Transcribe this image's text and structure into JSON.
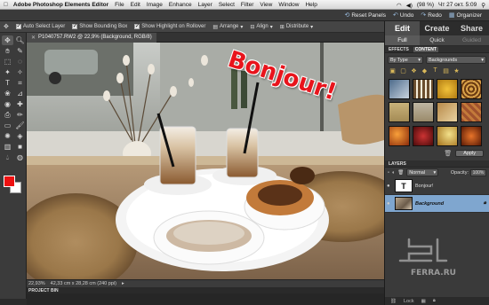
{
  "menubar": {
    "apple": "",
    "app_name": "Adobe Photoshop Elements Editor",
    "items": [
      "File",
      "Edit",
      "Image",
      "Enhance",
      "Layer",
      "Select",
      "Filter",
      "View",
      "Window",
      "Help"
    ],
    "battery": "(98 %)",
    "clock": "Чт 27 окт.  5:09"
  },
  "appbar": {
    "reset_label": "Reset Panels",
    "undo_label": "Undo",
    "redo_label": "Redo",
    "organizer_label": "Organizer"
  },
  "options": {
    "auto_select": "Auto Select Layer",
    "show_bounding": "Show Bounding Box",
    "show_highlight": "Show Highlight on Rollover",
    "arrange": "Arrange",
    "align": "Align",
    "distribute": "Distribute"
  },
  "document": {
    "tab_title": "P1040757.RW2 @ 22,9% (Background, RGB/8)",
    "overlay_text": "Bonjour!"
  },
  "status": {
    "zoom": "22,93%",
    "size": "42,33 cm x 28,28 cm (240 ppi)"
  },
  "project_bin": "PROJECT BIN",
  "panel": {
    "main_tabs": [
      "Edit",
      "Create",
      "Share"
    ],
    "sub_tabs": [
      "Full",
      "Quick",
      "Guided"
    ],
    "effects_tabs": [
      "EFFECTS",
      "CONTENT"
    ],
    "filter_by": "By Type",
    "category": "Backgrounds",
    "apply_label": "Apply",
    "layers_title": "LAYERS",
    "blend_mode": "Normal",
    "opacity_label": "Opacity:",
    "opacity_value": "100%",
    "layers": [
      {
        "name": "Bonjour!",
        "thumb": "T"
      },
      {
        "name": "Background",
        "thumb": ""
      }
    ],
    "lock_label": "Lock"
  },
  "watermark": "FERRA.RU",
  "colors": {
    "foreground": "#e11111",
    "background": "#ffffff",
    "selection": "#7fa6cf"
  },
  "content_swatches": [
    "#4c6a8a",
    "#6b4e2e",
    "#f1c23a",
    "#d8a24a",
    "#c9b27a",
    "#9a8a6a",
    "#b88a4a",
    "#a0522d",
    "#e8742a",
    "#8b1c1c",
    "#f2e08a",
    "#d13a1a"
  ]
}
